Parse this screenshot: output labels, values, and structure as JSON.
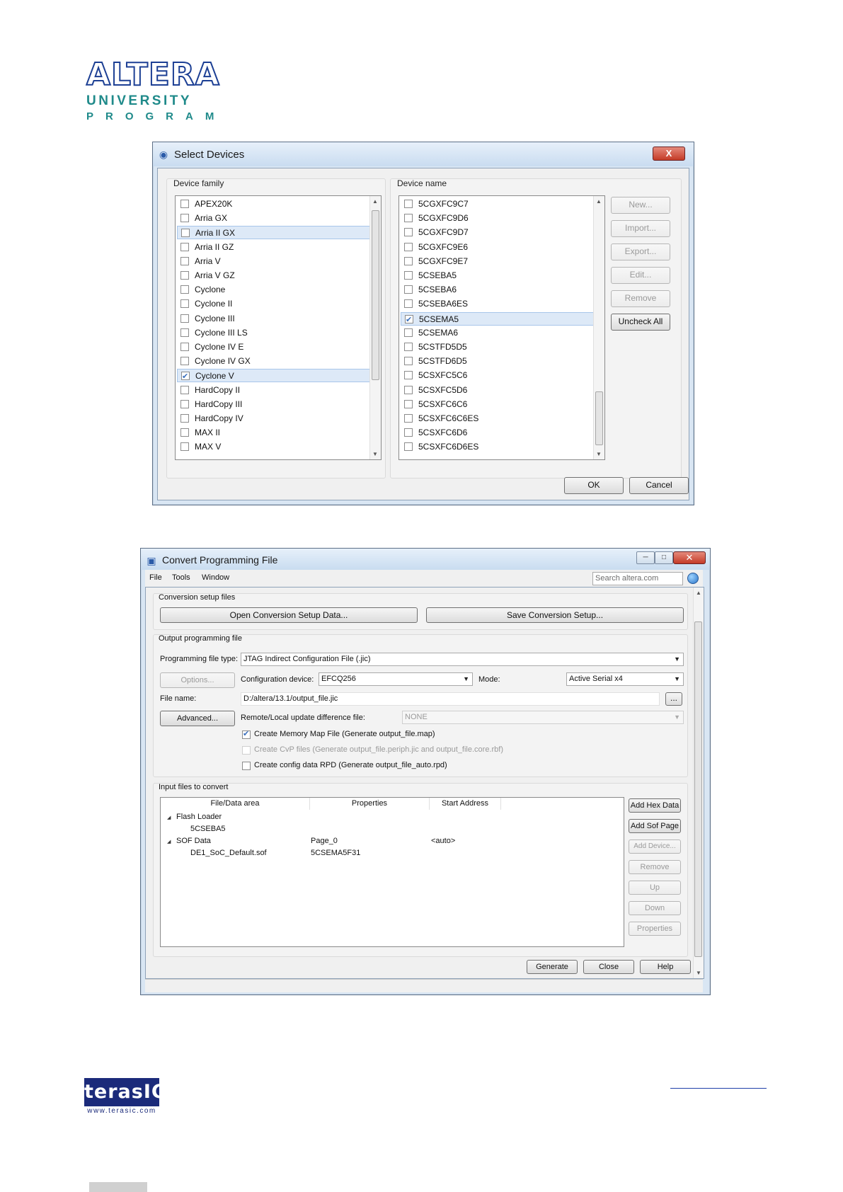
{
  "logo": {
    "brand": "ALTERA",
    "line2": "UNIVERSITY",
    "line3": "PROGRAM"
  },
  "select_devices": {
    "title": "Select Devices",
    "close_glyph": "X",
    "family_group_label": "Device family",
    "name_group_label": "Device name",
    "families": [
      {
        "label": "APEX20K",
        "checked": false
      },
      {
        "label": "Arria GX",
        "checked": false
      },
      {
        "label": "Arria II GX",
        "checked": false
      },
      {
        "label": "Arria II GZ",
        "checked": false
      },
      {
        "label": "Arria V",
        "checked": false
      },
      {
        "label": "Arria V GZ",
        "checked": false
      },
      {
        "label": "Cyclone",
        "checked": false
      },
      {
        "label": "Cyclone II",
        "checked": false
      },
      {
        "label": "Cyclone III",
        "checked": false
      },
      {
        "label": "Cyclone III LS",
        "checked": false
      },
      {
        "label": "Cyclone IV E",
        "checked": false
      },
      {
        "label": "Cyclone IV GX",
        "checked": false
      },
      {
        "label": "Cyclone V",
        "checked": true
      },
      {
        "label": "HardCopy II",
        "checked": false
      },
      {
        "label": "HardCopy III",
        "checked": false
      },
      {
        "label": "HardCopy IV",
        "checked": false
      },
      {
        "label": "MAX II",
        "checked": false
      },
      {
        "label": "MAX V",
        "checked": false
      }
    ],
    "devices": [
      {
        "label": "5CGXFC9C7",
        "checked": false
      },
      {
        "label": "5CGXFC9D6",
        "checked": false
      },
      {
        "label": "5CGXFC9D7",
        "checked": false
      },
      {
        "label": "5CGXFC9E6",
        "checked": false
      },
      {
        "label": "5CGXFC9E7",
        "checked": false
      },
      {
        "label": "5CSEBA5",
        "checked": false
      },
      {
        "label": "5CSEBA6",
        "checked": false
      },
      {
        "label": "5CSEBA6ES",
        "checked": false
      },
      {
        "label": "5CSEMA5",
        "checked": true
      },
      {
        "label": "5CSEMA6",
        "checked": false
      },
      {
        "label": "5CSTFD5D5",
        "checked": false
      },
      {
        "label": "5CSTFD6D5",
        "checked": false
      },
      {
        "label": "5CSXFC5C6",
        "checked": false
      },
      {
        "label": "5CSXFC5D6",
        "checked": false
      },
      {
        "label": "5CSXFC6C6",
        "checked": false
      },
      {
        "label": "5CSXFC6C6ES",
        "checked": false
      },
      {
        "label": "5CSXFC6D6",
        "checked": false
      },
      {
        "label": "5CSXFC6D6ES",
        "checked": false
      }
    ],
    "side_buttons": {
      "new": "New...",
      "import": "Import...",
      "export": "Export...",
      "edit": "Edit...",
      "remove": "Remove",
      "uncheck_all": "Uncheck All"
    },
    "ok": "OK",
    "cancel": "Cancel"
  },
  "convert": {
    "title": "Convert Programming File",
    "menu": {
      "file": "File",
      "tools": "Tools",
      "window": "Window"
    },
    "search_placeholder": "Search altera.com",
    "setup_group_label": "Conversion setup files",
    "open_setup": "Open Conversion Setup Data...",
    "save_setup": "Save Conversion Setup...",
    "output_group_label": "Output programming file",
    "file_type_label": "Programming file type:",
    "file_type_value": "JTAG Indirect Configuration File (.jic)",
    "options_button": "Options...",
    "config_device_label": "Configuration device:",
    "config_device_value": "EFCQ256",
    "mode_label": "Mode:",
    "mode_value": "Active Serial x4",
    "file_name_label": "File name:",
    "file_name_value": "D:/altera/13.1/output_file.jic",
    "browse_button": "...",
    "advanced_button": "Advanced...",
    "remote_label": "Remote/Local update difference file:",
    "remote_value": "NONE",
    "check_map": {
      "label": "Create Memory Map File (Generate output_file.map)",
      "checked": true
    },
    "check_cvp": {
      "label": "Create CvP files (Generate output_file.periph.jic and output_file.core.rbf)",
      "checked": false
    },
    "check_rpd": {
      "label": "Create config data RPD (Generate output_file_auto.rpd)",
      "checked": false
    },
    "input_group_label": "Input files to convert",
    "columns": [
      "File/Data area",
      "Properties",
      "Start Address"
    ],
    "tree": {
      "flash_loader": "Flash Loader",
      "flash_child": "5CSEBA5",
      "sof_data": "SOF Data",
      "sof_properties": "Page_0",
      "sof_start": "<auto>",
      "sof_file": "DE1_SoC_Default.sof",
      "sof_file_properties": "5CSEMA5F31"
    },
    "input_buttons": {
      "add_hex": "Add Hex Data",
      "add_sof": "Add Sof Page",
      "add_device": "Add Device...",
      "remove": "Remove",
      "up": "Up",
      "down": "Down",
      "properties": "Properties"
    },
    "generate": "Generate",
    "close": "Close",
    "help": "Help"
  },
  "footer": {
    "brand": "terasIC",
    "url": "www.terasic.com"
  }
}
